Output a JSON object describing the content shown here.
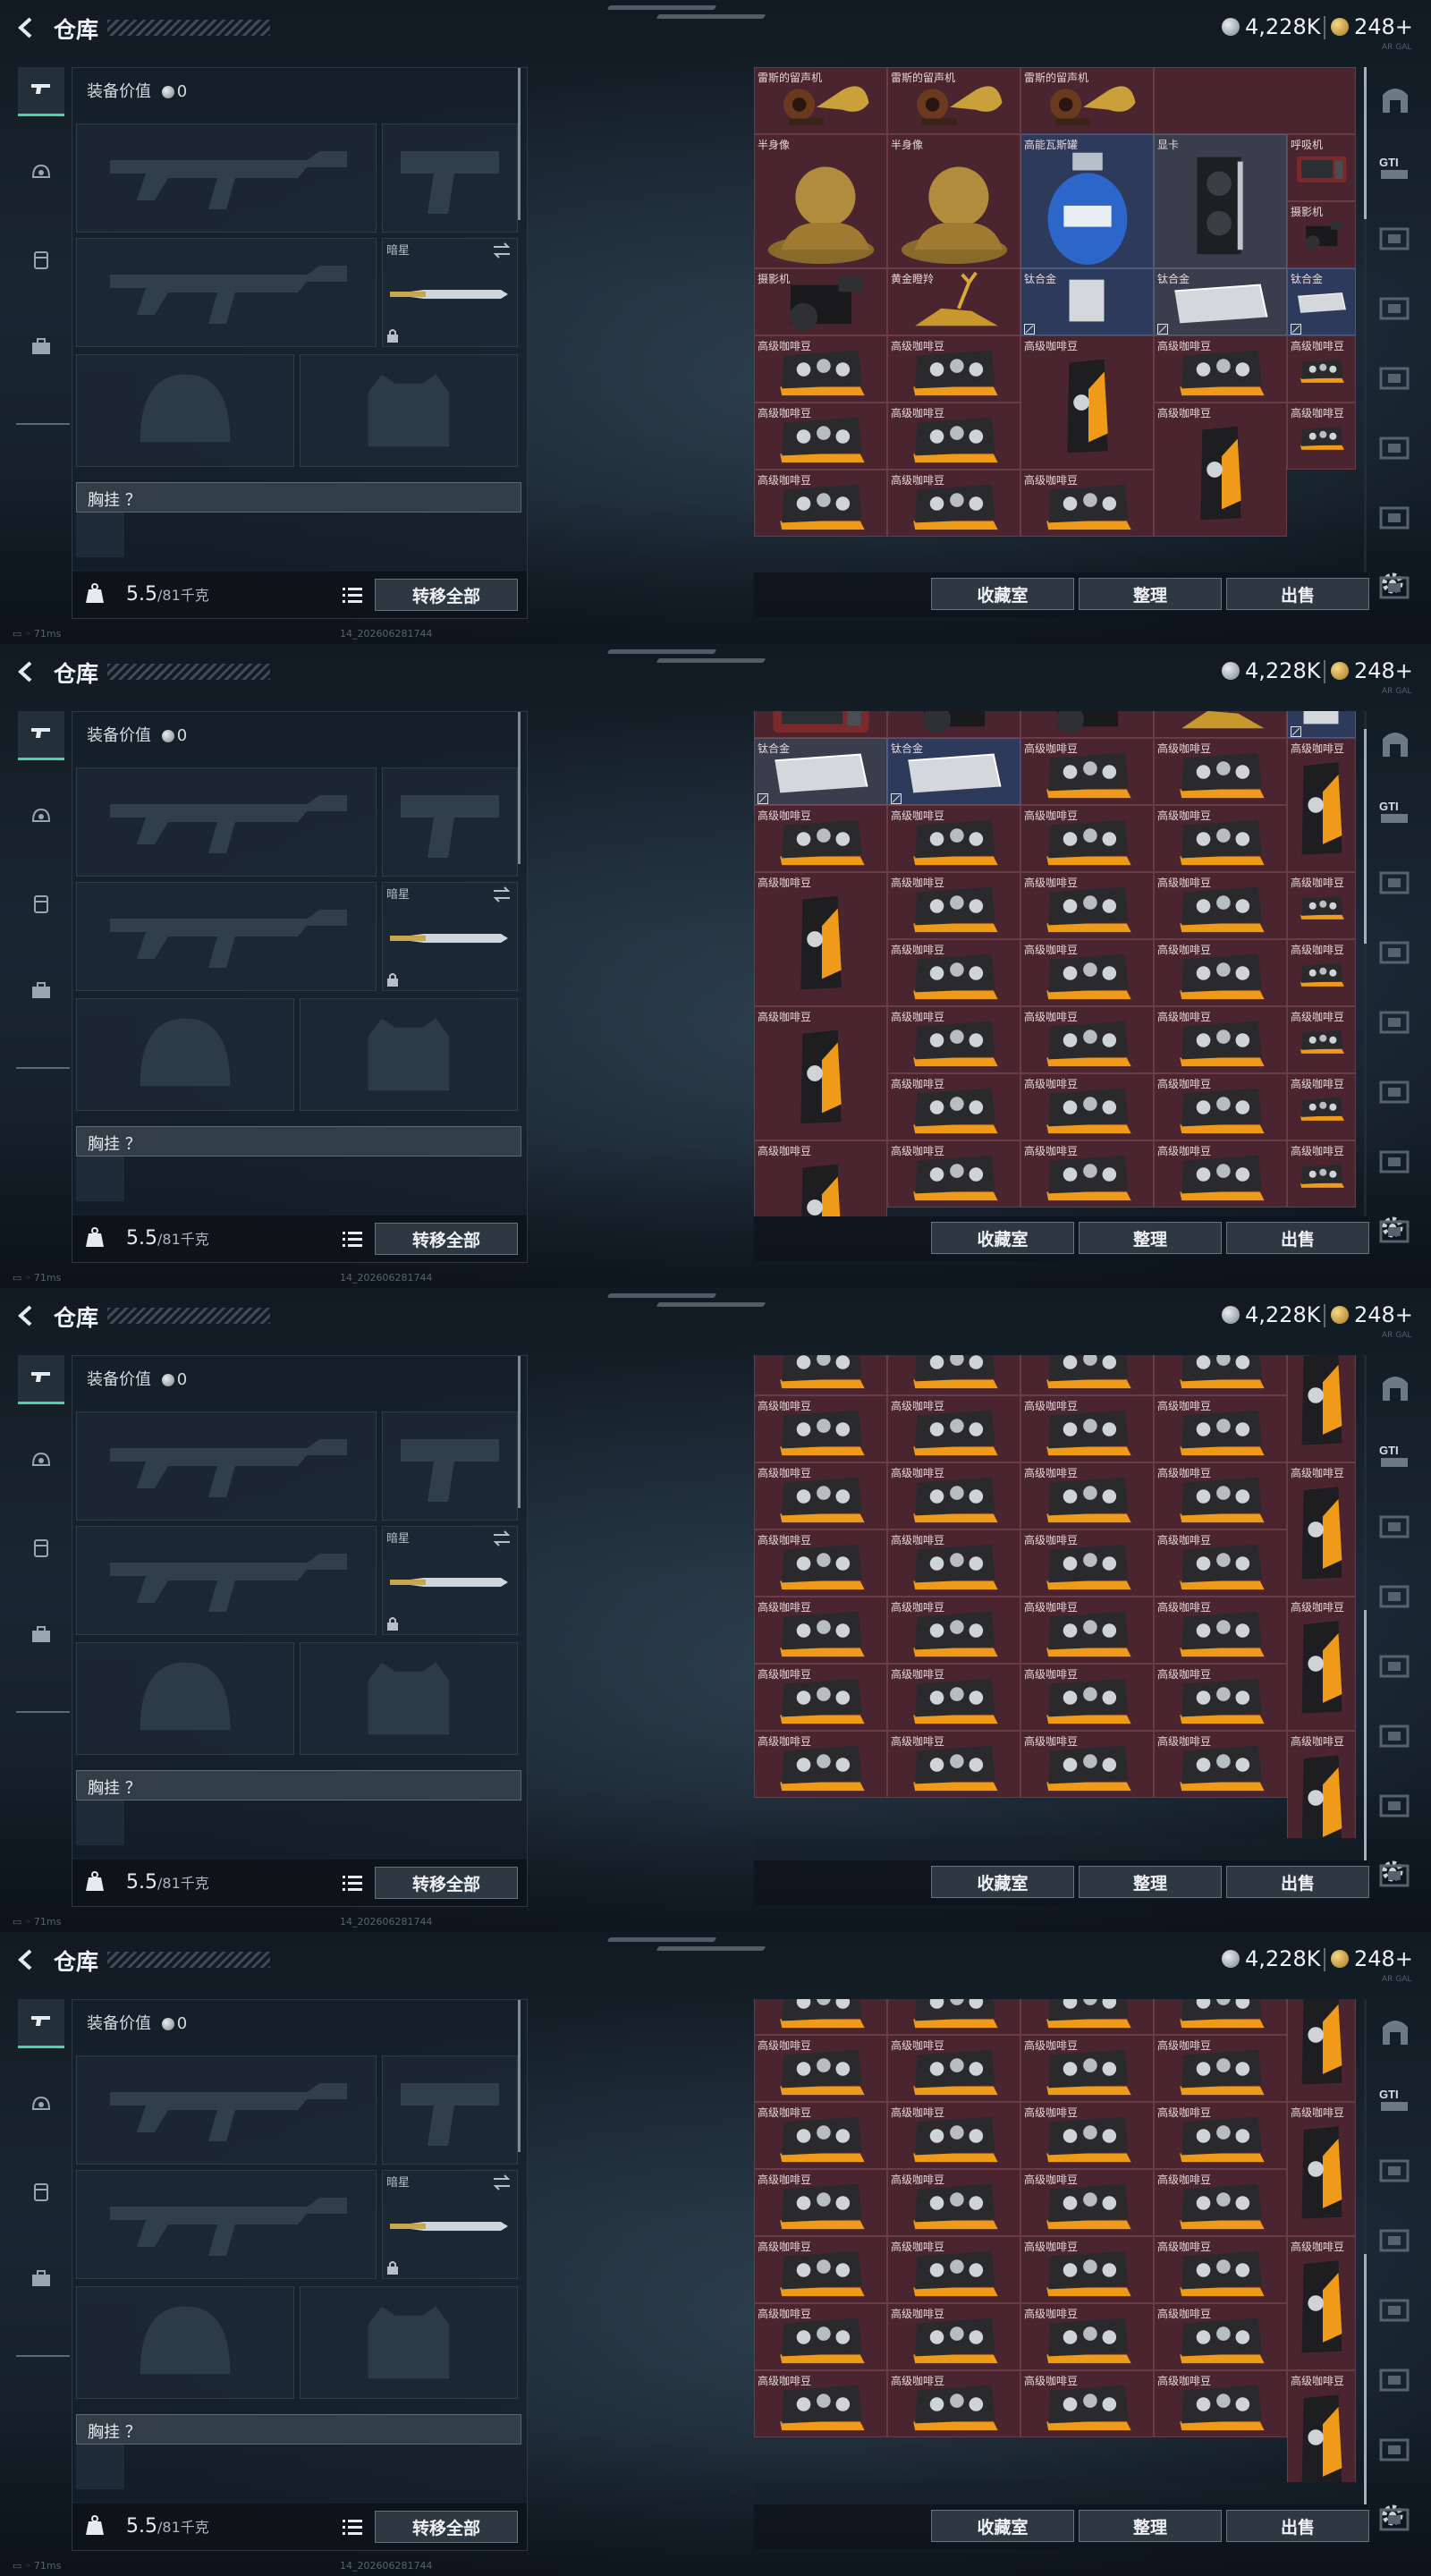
{
  "header": {
    "title": "仓库",
    "silver": "4,228K",
    "gold": "248+"
  },
  "equipment": {
    "value_label": "装备价值",
    "value": "0",
    "knife_label": "暗星",
    "chest_label": "胸挂 ？",
    "weight": "5.5",
    "weight_max": "/81千克",
    "transfer_all": "转移全部"
  },
  "inventory_buttons": {
    "collection": "收藏室",
    "organize": "整理",
    "sell": "出售"
  },
  "footer": {
    "ping": "71ms",
    "version": "14_202606281744"
  },
  "rail_tip": "AR GAL",
  "nav": [
    {
      "name": "nav-weapons",
      "icon": "pistol-icon"
    },
    {
      "name": "nav-armor",
      "icon": "helmet-icon"
    },
    {
      "name": "nav-vest",
      "icon": "vest-icon"
    },
    {
      "name": "nav-case",
      "icon": "briefcase-icon"
    }
  ],
  "rail": [
    {
      "icon": "stash-arch-icon",
      "label": ""
    },
    {
      "icon": "gti-icon",
      "label": "GTI"
    },
    {
      "icon": "container-icon",
      "label": ""
    },
    {
      "icon": "container-icon",
      "label": ""
    },
    {
      "icon": "container-icon",
      "label": ""
    },
    {
      "icon": "container-icon",
      "label": ""
    },
    {
      "icon": "container-icon",
      "label": ""
    },
    {
      "icon": "container-icon",
      "label": ""
    },
    {
      "icon": "container-icon",
      "label": ""
    }
  ],
  "item_names": {
    "gramophone": "雷斯的留声机",
    "bust": "半身像",
    "gas": "高能瓦斯罐",
    "gpu": "显卡",
    "pager": "呼吸机",
    "camera": "摄影机",
    "deer": "黄金瞪羚",
    "titanium": "钛合金",
    "coffee": "高级咖啡豆"
  },
  "colors": {
    "accent": "#4fd1a8",
    "item_bg": "#4a2530",
    "panel_bg": "#16202a"
  }
}
